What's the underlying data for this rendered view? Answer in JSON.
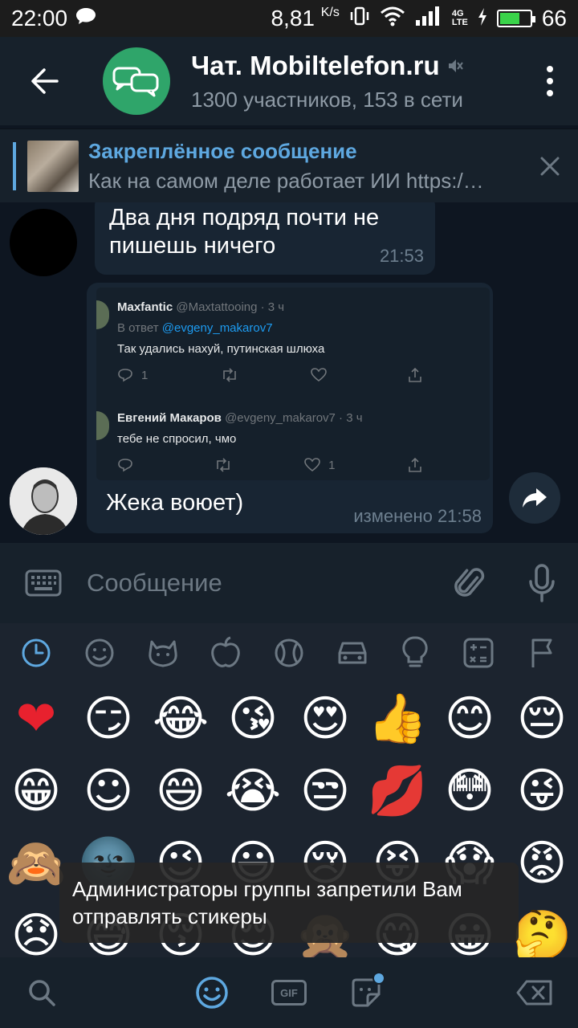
{
  "status_bar": {
    "time": "22:00",
    "net_speed": "8,81",
    "net_unit": "K/s",
    "battery_level": "66",
    "battery_percent": 0.66,
    "signal_label_top": "4G",
    "signal_label_bottom": "LTE"
  },
  "header": {
    "title": "Чат. Mobiltelefon.ru",
    "subtitle": "1300 участников, 153 в сети",
    "avatar_color": "#2fa56a"
  },
  "pinned": {
    "title": "Закреплённое сообщение",
    "body": "Как на самом деле работает ИИ https:/…"
  },
  "messages": [
    {
      "text_line1": "Два дня подряд почти не",
      "text_line2": "пишешь ничего",
      "time": "21:53"
    },
    {
      "text": "Жека воюет)",
      "time": "изменено 21:58",
      "tweets": [
        {
          "name": "Maxfantic",
          "meta": "@Maxtattooing · 3 ч",
          "reply_prefix": "В ответ",
          "reply_to": "@evgeny_makarov7",
          "text": "Так удались нахуй, путинская шлюха",
          "replies": "1",
          "likes": ""
        },
        {
          "name": "Евгений Макаров",
          "meta": "@evgeny_makarov7 · 3 ч",
          "text": "тебе не спросил, чмо",
          "replies": "",
          "likes": "1"
        }
      ]
    }
  ],
  "input": {
    "placeholder": "Сообщение"
  },
  "emoji_categories": [
    "recent-icon",
    "smileys-icon",
    "animals-icon",
    "food-icon",
    "sports-icon",
    "travel-icon",
    "objects-icon",
    "symbols-icon",
    "flags-icon"
  ],
  "emojis": [
    "❤",
    "😏",
    "😂",
    "😘",
    "😍",
    "👍",
    "😊",
    "😔",
    "😁",
    "☺",
    "😄",
    "😭",
    "😒",
    "💋",
    "😳",
    "😜",
    "🙈",
    "🌚",
    "😉",
    "😃",
    "😢",
    "😝",
    "😱",
    "😡",
    "😞",
    "😅",
    "😚",
    "😌",
    "🙊",
    "😋",
    "😀",
    "🤔"
  ],
  "toast": {
    "line1": "Администраторы группы запретили Вам",
    "line2": "отправлять стикеры"
  },
  "bottom_tabs": {
    "gif_label": "GIF"
  },
  "colors": {
    "accent": "#5ea8e0",
    "bubble": "#182533",
    "header_bg": "#17212b",
    "chat_bg": "#0e1621"
  }
}
